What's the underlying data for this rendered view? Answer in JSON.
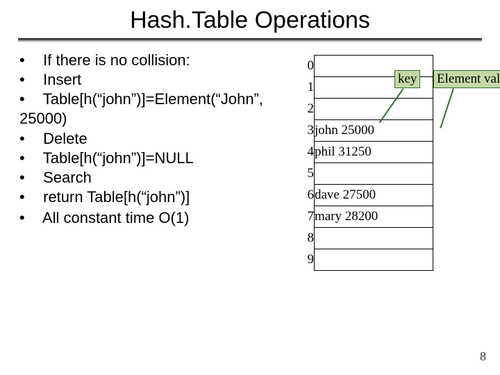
{
  "title": "Hash.Table Operations",
  "bullets": {
    "no_collision": "If there is no collision:",
    "insert": "Insert",
    "insert_code": "Table[h(“john”)]=Element(“John”, 25000)",
    "delete": "Delete",
    "delete_code": "Table[h(“john”)]=NULL",
    "search": "Search",
    "search_code": "return Table[h(“john”)]",
    "complexity": "All constant time O(1)"
  },
  "callouts": {
    "key": "key",
    "value": "Element value"
  },
  "table": {
    "rows": [
      {
        "idx": "0",
        "value": ""
      },
      {
        "idx": "1",
        "value": ""
      },
      {
        "idx": "2",
        "value": ""
      },
      {
        "idx": "3",
        "value": "john 25000"
      },
      {
        "idx": "4",
        "value": "phil 31250"
      },
      {
        "idx": "5",
        "value": ""
      },
      {
        "idx": "6",
        "value": "dave 27500"
      },
      {
        "idx": "7",
        "value": "mary 28200"
      },
      {
        "idx": "8",
        "value": ""
      },
      {
        "idx": "9",
        "value": ""
      }
    ]
  },
  "page_number": "8"
}
